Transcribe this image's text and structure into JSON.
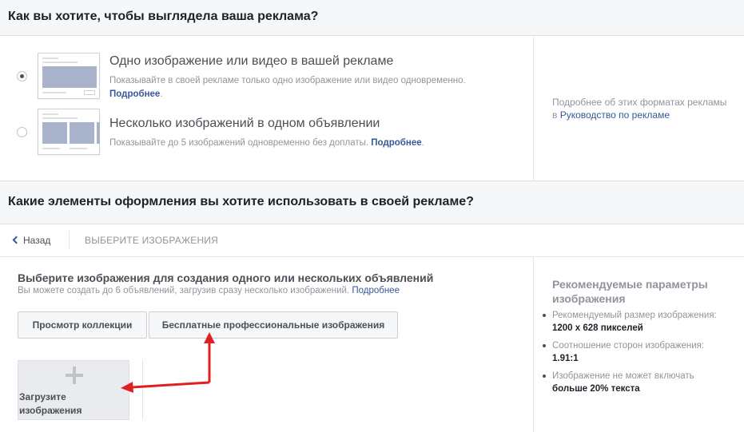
{
  "sections": {
    "format_title": "Как вы хотите, чтобы выглядела ваша реклама?",
    "creative_title": "Какие элементы оформления вы хотите использовать в своей рекламе?"
  },
  "format_options": [
    {
      "title": "Одно изображение или видео в вашей рекламе",
      "description": "Показывайте в своей рекламе только одно изображение или видео одновременно.",
      "link": "Подробнее",
      "selected": true
    },
    {
      "title": "Несколько изображений в одном объявлении",
      "description": "Показывайте до 5 изображений одновременно без доплаты.",
      "link": "Подробнее",
      "selected": false
    }
  ],
  "format_side": {
    "text": "Подробнее об этих форматах рекламы в",
    "link": "Руководство по рекламе"
  },
  "nav": {
    "back": "Назад",
    "breadcrumb": "ВЫБЕРИТЕ ИЗОБРАЖЕНИЯ"
  },
  "images": {
    "title": "Выберите изображения для создания одного или нескольких объявлений",
    "subtitle": "Вы можете создать до 6 объявлений, загрузив сразу несколько изображений.",
    "subtitle_link": "Подробнее",
    "browse_library": "Просмотр коллекции",
    "free_stock": "Бесплатные профессиональные изображения",
    "upload_line1": "Загрузите",
    "upload_line2": "изображения"
  },
  "recommended": {
    "title": "Рекомендуемые параметры изображения",
    "items": [
      {
        "label": "Рекомендуемый размер изображения:",
        "value": "1200 x 628 пикселей"
      },
      {
        "label": "Соотношение сторон изображения:",
        "value": "1.91:1"
      },
      {
        "label": "Изображение не может включать",
        "value": "больше 20% текста"
      }
    ]
  },
  "colors": {
    "link": "#365899",
    "annotation_arrow": "#e02020",
    "thumbnail_block": "#a9b3cb"
  }
}
